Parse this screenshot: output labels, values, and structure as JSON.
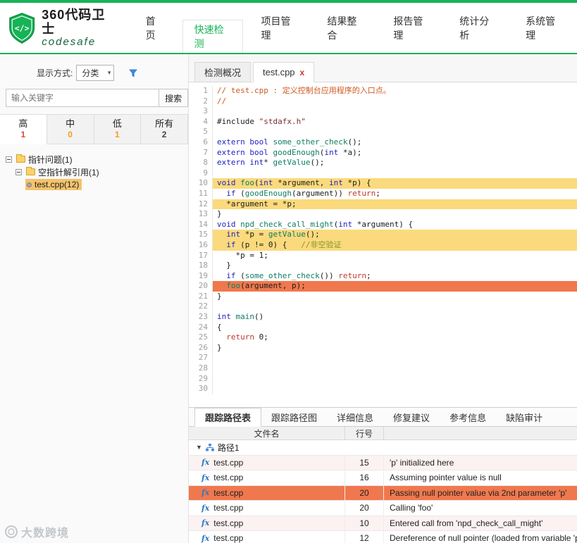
{
  "brand": {
    "title": "360代码卫士",
    "subtitle": "codesafe"
  },
  "nav": {
    "items": [
      {
        "label": "首页",
        "active": false
      },
      {
        "label": "快速检测",
        "active": true
      },
      {
        "label": "项目管理",
        "active": false
      },
      {
        "label": "结果整合",
        "active": false
      },
      {
        "label": "报告管理",
        "active": false
      },
      {
        "label": "统计分析",
        "active": false
      },
      {
        "label": "系统管理",
        "active": false
      }
    ]
  },
  "sidebar": {
    "display_mode_label": "显示方式:",
    "display_mode_value": "分类",
    "search": {
      "placeholder": "输入关键字",
      "button": "搜索"
    },
    "severity_tabs": [
      {
        "label": "高",
        "count": "1",
        "active": true,
        "count_color": "#e2483d"
      },
      {
        "label": "中",
        "count": "0",
        "active": false,
        "count_color": "#f59b22"
      },
      {
        "label": "低",
        "count": "1",
        "active": false,
        "count_color": "#f59b22"
      },
      {
        "label": "所有",
        "count": "2",
        "active": false,
        "count_color": "#444444"
      }
    ],
    "tree": [
      {
        "label": "指针问题(1)",
        "level": 0,
        "type": "folder",
        "selected": false
      },
      {
        "label": "空指针解引用(1)",
        "level": 1,
        "type": "folder",
        "selected": false
      },
      {
        "label": "test.cpp(12)",
        "level": 2,
        "type": "file",
        "selected": true
      }
    ]
  },
  "editor": {
    "tabs": [
      {
        "label": "检测概况",
        "active": false,
        "closable": false
      },
      {
        "label": "test.cpp",
        "active": true,
        "closable": true
      }
    ],
    "close_glyph": "x",
    "code_lines": [
      {
        "n": "1",
        "hl": "",
        "seg": [
          {
            "t": "// test.cpp : 定义控制台应用程序的入口点。",
            "c": "cm"
          }
        ]
      },
      {
        "n": "2",
        "hl": "",
        "seg": [
          {
            "t": "//",
            "c": "cm"
          }
        ]
      },
      {
        "n": "3",
        "hl": "",
        "seg": []
      },
      {
        "n": "4",
        "hl": "",
        "seg": [
          {
            "t": "#include ",
            "c": ""
          },
          {
            "t": "\"stdafx.h\"",
            "c": "str"
          }
        ]
      },
      {
        "n": "5",
        "hl": "",
        "seg": []
      },
      {
        "n": "6",
        "hl": "",
        "seg": [
          {
            "t": "extern",
            "c": "kw"
          },
          {
            "t": " ",
            "c": ""
          },
          {
            "t": "bool",
            "c": "kw"
          },
          {
            "t": " ",
            "c": ""
          },
          {
            "t": "some_other_check",
            "c": "fn"
          },
          {
            "t": "();",
            "c": ""
          }
        ]
      },
      {
        "n": "7",
        "hl": "",
        "seg": [
          {
            "t": "extern",
            "c": "kw"
          },
          {
            "t": " ",
            "c": ""
          },
          {
            "t": "bool",
            "c": "kw"
          },
          {
            "t": " ",
            "c": ""
          },
          {
            "t": "goodEnough",
            "c": "fn"
          },
          {
            "t": "(",
            "c": ""
          },
          {
            "t": "int",
            "c": "kw"
          },
          {
            "t": " *a);",
            "c": ""
          }
        ]
      },
      {
        "n": "8",
        "hl": "",
        "seg": [
          {
            "t": "extern",
            "c": "kw"
          },
          {
            "t": " ",
            "c": ""
          },
          {
            "t": "int",
            "c": "kw"
          },
          {
            "t": "* ",
            "c": ""
          },
          {
            "t": "getValue",
            "c": "fn"
          },
          {
            "t": "();",
            "c": ""
          }
        ]
      },
      {
        "n": "9",
        "hl": "",
        "seg": []
      },
      {
        "n": "10",
        "hl": "y",
        "seg": [
          {
            "t": "void",
            "c": "kw"
          },
          {
            "t": " ",
            "c": ""
          },
          {
            "t": "foo",
            "c": "fn"
          },
          {
            "t": "(",
            "c": ""
          },
          {
            "t": "int",
            "c": "kw"
          },
          {
            "t": " *argument, ",
            "c": ""
          },
          {
            "t": "int",
            "c": "kw"
          },
          {
            "t": " *p) {",
            "c": ""
          }
        ]
      },
      {
        "n": "11",
        "hl": "",
        "seg": [
          {
            "t": "  ",
            "c": ""
          },
          {
            "t": "if",
            "c": "kw"
          },
          {
            "t": " (",
            "c": ""
          },
          {
            "t": "goodEnough",
            "c": "fn"
          },
          {
            "t": "(argument)) ",
            "c": ""
          },
          {
            "t": "return",
            "c": "ret"
          },
          {
            "t": ";",
            "c": ""
          }
        ]
      },
      {
        "n": "12",
        "hl": "y",
        "seg": [
          {
            "t": "  *argument = *p;",
            "c": ""
          }
        ]
      },
      {
        "n": "13",
        "hl": "",
        "seg": [
          {
            "t": "}",
            "c": ""
          }
        ]
      },
      {
        "n": "14",
        "hl": "",
        "seg": [
          {
            "t": "void",
            "c": "kw"
          },
          {
            "t": " ",
            "c": ""
          },
          {
            "t": "npd_check_call_might",
            "c": "fn"
          },
          {
            "t": "(",
            "c": ""
          },
          {
            "t": "int",
            "c": "kw"
          },
          {
            "t": " *argument) {",
            "c": ""
          }
        ]
      },
      {
        "n": "15",
        "hl": "y",
        "seg": [
          {
            "t": "  ",
            "c": ""
          },
          {
            "t": "int",
            "c": "kw"
          },
          {
            "t": " *p = ",
            "c": ""
          },
          {
            "t": "getValue",
            "c": "fn"
          },
          {
            "t": "();",
            "c": ""
          }
        ]
      },
      {
        "n": "16",
        "hl": "y",
        "seg": [
          {
            "t": "  ",
            "c": ""
          },
          {
            "t": "if",
            "c": "kw"
          },
          {
            "t": " (p != 0) {   ",
            "c": ""
          },
          {
            "t": "//非空验证",
            "c": "cm2"
          }
        ]
      },
      {
        "n": "17",
        "hl": "",
        "seg": [
          {
            "t": "    *p = 1;",
            "c": ""
          }
        ]
      },
      {
        "n": "18",
        "hl": "",
        "seg": [
          {
            "t": "  }",
            "c": ""
          }
        ]
      },
      {
        "n": "19",
        "hl": "",
        "seg": [
          {
            "t": "  ",
            "c": ""
          },
          {
            "t": "if",
            "c": "kw"
          },
          {
            "t": " (",
            "c": ""
          },
          {
            "t": "some_other_check",
            "c": "fn"
          },
          {
            "t": "()) ",
            "c": ""
          },
          {
            "t": "return",
            "c": "ret"
          },
          {
            "t": ";",
            "c": ""
          }
        ]
      },
      {
        "n": "20",
        "hl": "o",
        "seg": [
          {
            "t": "  ",
            "c": ""
          },
          {
            "t": "foo",
            "c": "fn"
          },
          {
            "t": "(argument, p);",
            "c": ""
          }
        ]
      },
      {
        "n": "21",
        "hl": "",
        "seg": [
          {
            "t": "}",
            "c": ""
          }
        ]
      },
      {
        "n": "22",
        "hl": "",
        "seg": []
      },
      {
        "n": "23",
        "hl": "",
        "seg": [
          {
            "t": "int",
            "c": "kw"
          },
          {
            "t": " ",
            "c": ""
          },
          {
            "t": "main",
            "c": "fn"
          },
          {
            "t": "()",
            "c": ""
          }
        ]
      },
      {
        "n": "24",
        "hl": "",
        "seg": [
          {
            "t": "{",
            "c": ""
          }
        ]
      },
      {
        "n": "25",
        "hl": "",
        "seg": [
          {
            "t": "  ",
            "c": ""
          },
          {
            "t": "return",
            "c": "ret"
          },
          {
            "t": " 0;",
            "c": ""
          }
        ]
      },
      {
        "n": "26",
        "hl": "",
        "seg": [
          {
            "t": "}",
            "c": ""
          }
        ]
      },
      {
        "n": "27",
        "hl": "",
        "seg": []
      },
      {
        "n": "28",
        "hl": "",
        "seg": []
      },
      {
        "n": "29",
        "hl": "",
        "seg": []
      },
      {
        "n": "30",
        "hl": "",
        "seg": []
      }
    ]
  },
  "bottom": {
    "tabs": [
      {
        "label": "跟踪路径表",
        "active": true
      },
      {
        "label": "跟踪路径图",
        "active": false
      },
      {
        "label": "详细信息",
        "active": false
      },
      {
        "label": "修复建议",
        "active": false
      },
      {
        "label": "参考信息",
        "active": false
      },
      {
        "label": "缺陷审计",
        "active": false
      }
    ],
    "table": {
      "headers": [
        "文件名",
        "行号",
        ""
      ],
      "group_label": "路径1",
      "rows": [
        {
          "file": "test.cpp",
          "line": "15",
          "desc": "'p' initialized here",
          "selected": false
        },
        {
          "file": "test.cpp",
          "line": "16",
          "desc": "Assuming pointer value is null",
          "selected": false
        },
        {
          "file": "test.cpp",
          "line": "20",
          "desc": "Passing null pointer value via 2nd parameter 'p'",
          "selected": true
        },
        {
          "file": "test.cpp",
          "line": "20",
          "desc": "Calling 'foo'",
          "selected": false
        },
        {
          "file": "test.cpp",
          "line": "10",
          "desc": "Entered call from 'npd_check_call_might'",
          "selected": false
        },
        {
          "file": "test.cpp",
          "line": "12",
          "desc": "Dereference of null pointer (loaded from variable 'p')",
          "selected": false
        }
      ]
    }
  },
  "icons": {
    "function_icon": "fx",
    "expand_triangle": "▼",
    "dropdown_arrow": "▾"
  },
  "watermark": "大数跨境",
  "colors": {
    "brand_green": "#17b357",
    "highlight_yellow": "#fbda7d",
    "highlight_selected": "#f0784e",
    "tree_selected": "#f5c36c",
    "row_alt": "#fcf2f2"
  }
}
